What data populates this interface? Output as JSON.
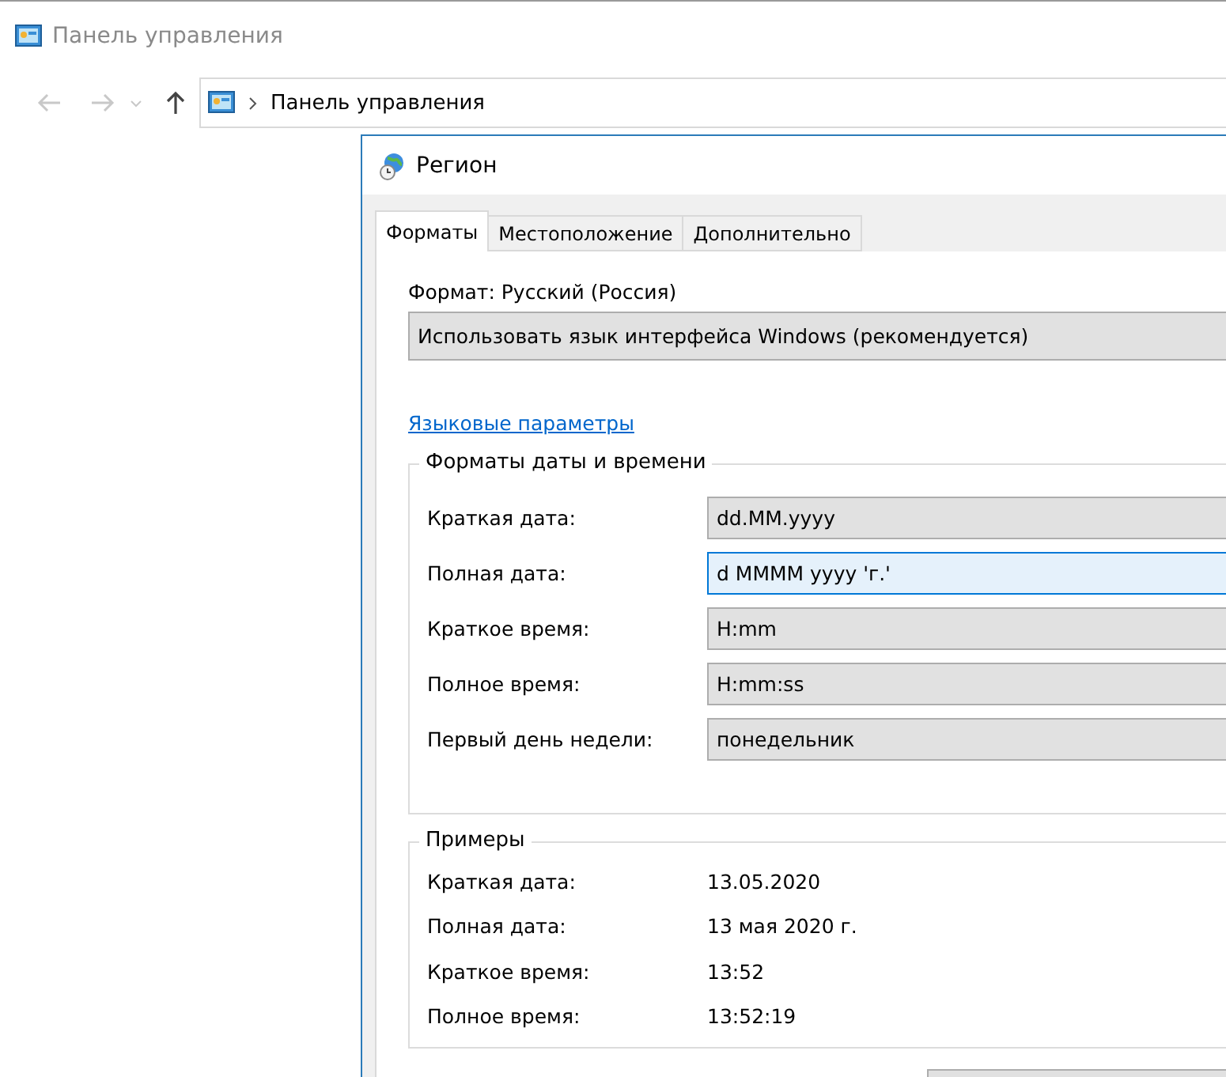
{
  "explorer": {
    "title": "Панель управления",
    "address": "Панель управления"
  },
  "dialog": {
    "title": "Регион",
    "tabs": [
      {
        "label": "Форматы",
        "selected": true
      },
      {
        "label": "Местоположение",
        "selected": false
      },
      {
        "label": "Дополнительно",
        "selected": false
      }
    ],
    "format_label": "Формат: Русский (Россия)",
    "format_value": "Использовать язык интерфейса Windows (рекомендуется)",
    "link": "Языковые параметры",
    "formats_group": {
      "title": "Форматы даты и времени",
      "rows": [
        {
          "label": "Краткая дата:",
          "value": "dd.MM.yyyy",
          "selected": false
        },
        {
          "label": "Полная дата:",
          "value": "d MMMM yyyy 'г.'",
          "selected": true
        },
        {
          "label": "Краткое время:",
          "value": "H:mm",
          "selected": false
        },
        {
          "label": "Полное время:",
          "value": "H:mm:ss",
          "selected": false
        },
        {
          "label": "Первый день недели:",
          "value": "понедельник",
          "selected": false
        }
      ]
    },
    "examples_group": {
      "title": "Примеры",
      "rows": [
        {
          "label": "Краткая дата:",
          "value": "13.05.2020"
        },
        {
          "label": "Полная дата:",
          "value": "13 мая 2020 г."
        },
        {
          "label": "Краткое время:",
          "value": "13:52"
        },
        {
          "label": "Полное время:",
          "value": "13:52:19"
        }
      ]
    }
  }
}
